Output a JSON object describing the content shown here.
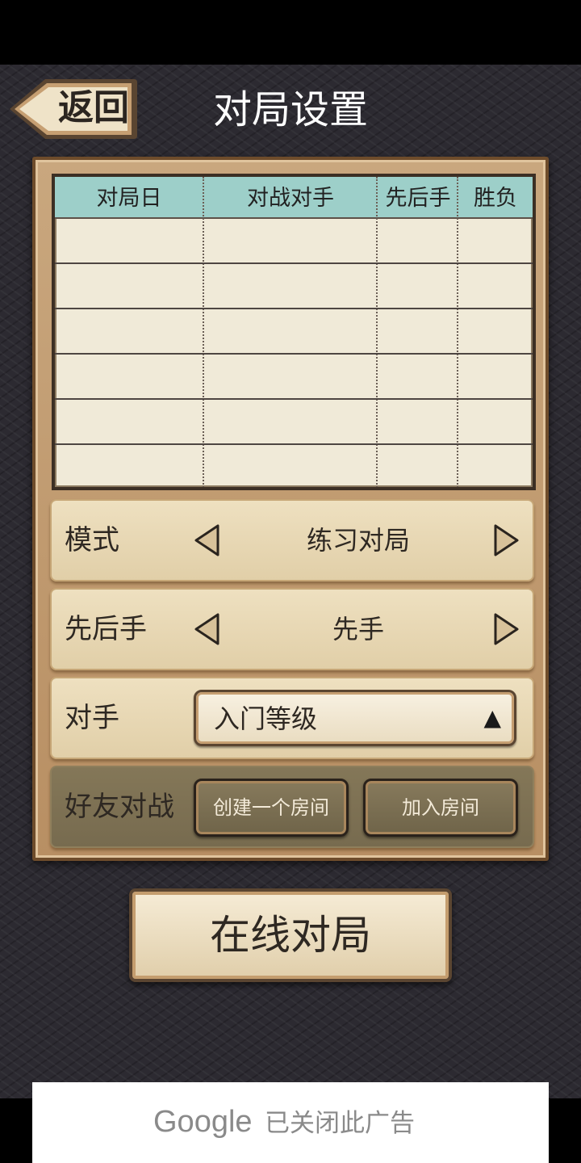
{
  "header": {
    "back_label": "返回",
    "title": "对局设置"
  },
  "record_table": {
    "columns": [
      "对局日",
      "对战对手",
      "先后手",
      "胜负"
    ],
    "rows": []
  },
  "settings": {
    "mode": {
      "label": "模式",
      "value": "练习对局"
    },
    "order": {
      "label": "先后手",
      "value": "先手"
    },
    "opponent": {
      "label": "对手",
      "value": "入门等级",
      "dropdown_icon": "▲"
    },
    "friend_match": {
      "label": "好友对战",
      "create_room": "创建一个房间",
      "join_room": "加入房间"
    }
  },
  "online_button": "在线对局",
  "ad": {
    "logo": "Google",
    "text": "已关闭此广告"
  },
  "colors": {
    "background": "#2c2a31",
    "panel": "#c9a77e",
    "table_header": "#9dcfc9",
    "table_body": "#f0ead8"
  }
}
